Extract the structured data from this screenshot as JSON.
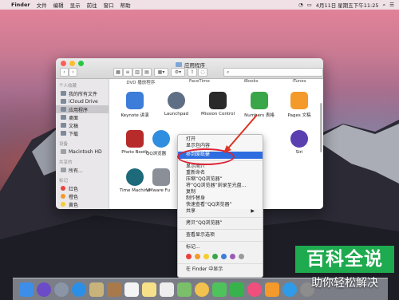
{
  "menubar": {
    "app_name": "Finder",
    "items": [
      "文件",
      "编辑",
      "显示",
      "前往",
      "窗口",
      "帮助"
    ],
    "datetime": "4月11日 星期五下午11:25"
  },
  "window": {
    "title": "应用程序"
  },
  "sidebar": {
    "sections": [
      {
        "header": "个人收藏",
        "items": [
          {
            "label": "我的所有文件",
            "selected": false
          },
          {
            "label": "iCloud Drive",
            "selected": false
          },
          {
            "label": "应用程序",
            "selected": true
          },
          {
            "label": "桌面",
            "selected": false
          },
          {
            "label": "文稿",
            "selected": false
          },
          {
            "label": "下载",
            "selected": false
          }
        ]
      },
      {
        "header": "设备",
        "items": [
          {
            "label": "Macintosh HD",
            "selected": false
          }
        ]
      },
      {
        "header": "共享的",
        "items": [
          {
            "label": "所有...",
            "selected": false
          }
        ]
      },
      {
        "header": "标记",
        "items": [
          {
            "label": "红色",
            "color": "#e8433b"
          },
          {
            "label": "橙色",
            "color": "#f39a2b"
          },
          {
            "label": "黄色",
            "color": "#f5cd30"
          }
        ]
      }
    ]
  },
  "apps_row0": [
    "DVD 播放程序",
    "FaceTime",
    "iBooks",
    "iTunes"
  ],
  "apps": [
    {
      "label": "Keynote 讲演",
      "color": "#3c7dd9"
    },
    {
      "label": "Launchpad",
      "color": "#5e6f85"
    },
    {
      "label": "Mission Control",
      "color": "#2a2a2a"
    },
    {
      "label": "Numbers 表格",
      "color": "#3aa64a"
    },
    {
      "label": "Pages 文稿",
      "color": "#f39a2b"
    },
    {
      "label": "Photo Booth",
      "color": "#b72b2b"
    },
    {
      "label": "QQ浏览器",
      "color": "#2f8ee0"
    },
    {
      "label": "Siri",
      "color": "#5a3fb0"
    },
    {
      "label": "Time Machine",
      "color": "#1c6a7a"
    },
    {
      "label": "VMware Fu",
      "color": "#8a8f98"
    }
  ],
  "context_menu": {
    "items": [
      "打开",
      "显示包内容",
      "移到废纸篓",
      "显示简介",
      "重新命名",
      "压缩“QQ浏览器”",
      "将“QQ浏览器”刻录至光盘...",
      "复制",
      "制作替身",
      "快速查看“QQ浏览器”",
      "共享",
      "拷贝“QQ浏览器”",
      "查看显示选项",
      "标记...",
      "在 Finder 中显示"
    ],
    "highlighted": "移到废纸篓",
    "tag_colors": [
      "#e8433b",
      "#f39a2b",
      "#f5cd30",
      "#3aa64a",
      "#3c7dd9",
      "#9b59b6",
      "#9a9a9a"
    ]
  },
  "watermark": {
    "line1": "百科全说",
    "line2": "助你轻松解决"
  },
  "dock": {
    "icons": [
      "finder-icon",
      "siri-icon",
      "launchpad-icon",
      "safari-icon",
      "mail-icon",
      "contacts-icon",
      "calendar-icon",
      "notes-icon",
      "reminders-icon",
      "maps-icon",
      "photos-icon",
      "messages-icon",
      "facetime-icon",
      "music-icon",
      "books-icon",
      "appstore-icon",
      "preferences-icon",
      "trash-icon"
    ]
  }
}
